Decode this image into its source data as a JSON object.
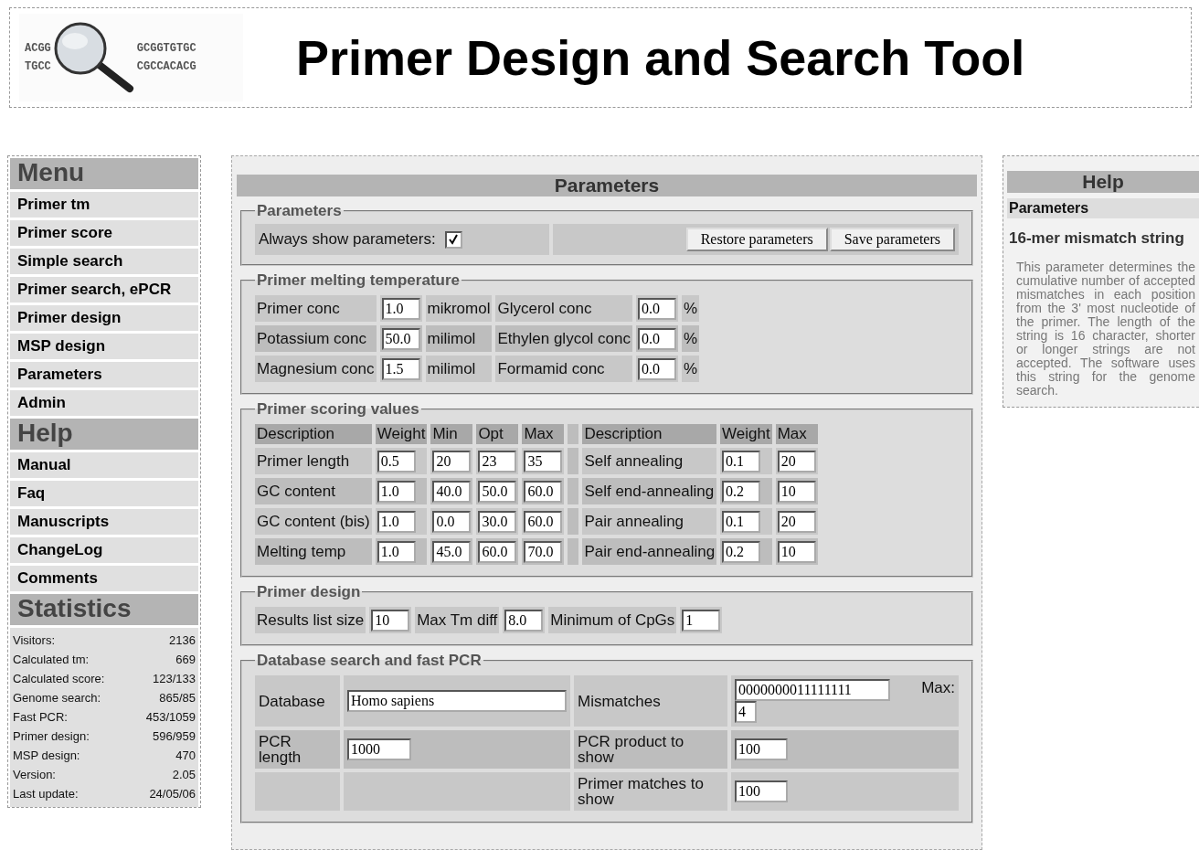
{
  "header": {
    "title": "Primer Design and Search Tool",
    "logo": {
      "left_lines": [
        "ACGG",
        "TGCC"
      ],
      "right_lines": [
        "GCGGTGTGC",
        "CGCCACACG"
      ]
    }
  },
  "sidebar": {
    "sections": [
      {
        "title": "Menu",
        "items": [
          {
            "label": "Primer tm"
          },
          {
            "label": "Primer score"
          },
          {
            "label": "Simple search"
          },
          {
            "label": "Primer search, ePCR"
          },
          {
            "label": "Primer design"
          },
          {
            "label": "MSP design"
          },
          {
            "label": "Parameters"
          },
          {
            "label": "Admin"
          }
        ]
      },
      {
        "title": "Help",
        "items": [
          {
            "label": "Manual"
          },
          {
            "label": "Faq"
          },
          {
            "label": "Manuscripts"
          },
          {
            "label": "ChangeLog"
          },
          {
            "label": "Comments"
          }
        ]
      }
    ],
    "statistics": {
      "title": "Statistics",
      "rows": [
        {
          "label": "Visitors:",
          "value": "2136"
        },
        {
          "label": "Calculated tm:",
          "value": "669"
        },
        {
          "label": "Calculated score:",
          "value": "123/133"
        },
        {
          "label": "Genome search:",
          "value": "865/85"
        },
        {
          "label": "Fast PCR:",
          "value": "453/1059"
        },
        {
          "label": "Primer design:",
          "value": "596/959"
        },
        {
          "label": "MSP design:",
          "value": "470"
        },
        {
          "label": "Version:",
          "value": "2.05"
        },
        {
          "label": "Last update:",
          "value": "24/05/06"
        }
      ]
    }
  },
  "main": {
    "title": "Parameters",
    "general": {
      "legend": "Parameters",
      "always_show": {
        "label": "Always show parameters:",
        "checked": true
      },
      "buttons": [
        "Restore parameters",
        "Save parameters"
      ]
    },
    "melting": {
      "legend": "Primer melting temperature",
      "rows": [
        {
          "cells": [
            {
              "label": "Primer conc",
              "value": "1.0",
              "unit": "mikromol"
            },
            {
              "label": "Glycerol conc",
              "value": "0.0",
              "unit": "%"
            }
          ]
        },
        {
          "cells": [
            {
              "label": "Potassium conc",
              "value": "50.0",
              "unit": "milimol"
            },
            {
              "label": "Ethylen glycol conc",
              "value": "0.0",
              "unit": "%"
            }
          ]
        },
        {
          "cells": [
            {
              "label": "Magnesium conc",
              "value": "1.5",
              "unit": "milimol"
            },
            {
              "label": "Formamid conc",
              "value": "0.0",
              "unit": "%"
            }
          ]
        }
      ]
    },
    "scoring": {
      "legend": "Primer scoring values",
      "left_columns": [
        "Description",
        "Weight",
        "Min",
        "Opt",
        "Max"
      ],
      "right_columns": [
        "Description",
        "Weight",
        "Max"
      ],
      "rows": [
        {
          "left": {
            "description": "Primer length",
            "values": [
              "0.5",
              "20",
              "23",
              "35"
            ]
          },
          "right": {
            "description": "Self annealing",
            "values": [
              "0.1",
              "20"
            ]
          }
        },
        {
          "left": {
            "description": "GC content",
            "values": [
              "1.0",
              "40.0",
              "50.0",
              "60.0"
            ]
          },
          "right": {
            "description": "Self end-annealing",
            "values": [
              "0.2",
              "10"
            ]
          }
        },
        {
          "left": {
            "description": "GC content (bis)",
            "values": [
              "1.0",
              "0.0",
              "30.0",
              "60.0"
            ]
          },
          "right": {
            "description": "Pair annealing",
            "values": [
              "0.1",
              "20"
            ]
          }
        },
        {
          "left": {
            "description": "Melting temp",
            "values": [
              "1.0",
              "45.0",
              "60.0",
              "70.0"
            ]
          },
          "right": {
            "description": "Pair end-annealing",
            "values": [
              "0.2",
              "10"
            ]
          }
        }
      ]
    },
    "design": {
      "legend": "Primer design",
      "fields": [
        {
          "label": "Results list size",
          "value": "10"
        },
        {
          "label": "Max Tm diff",
          "value": "8.0"
        },
        {
          "label": "Minimum of CpGs",
          "value": "1"
        }
      ]
    },
    "database": {
      "legend": "Database search and fast PCR",
      "database": {
        "label": "Database",
        "value": "Homo sapiens"
      },
      "mismatches": {
        "label": "Mismatches",
        "value": "0000000011111111",
        "max_label": "Max:",
        "max_value": "4"
      },
      "pcr_length": {
        "label": "PCR length",
        "value": "1000"
      },
      "pcr_product": {
        "label": "PCR product to show",
        "value": "100"
      },
      "primer_matches": {
        "label": "Primer matches to show",
        "value": "100"
      }
    }
  },
  "help": {
    "title": "Help",
    "section": "Parameters",
    "topic": "16-mer mismatch string",
    "text": "This parameter determines the cumulative number of accepted mismatches in each position from the 3' most nucleotide of the primer. The length of the string is 16 character, shorter or longer strings are not accepted. The software uses this string for the genome search."
  }
}
